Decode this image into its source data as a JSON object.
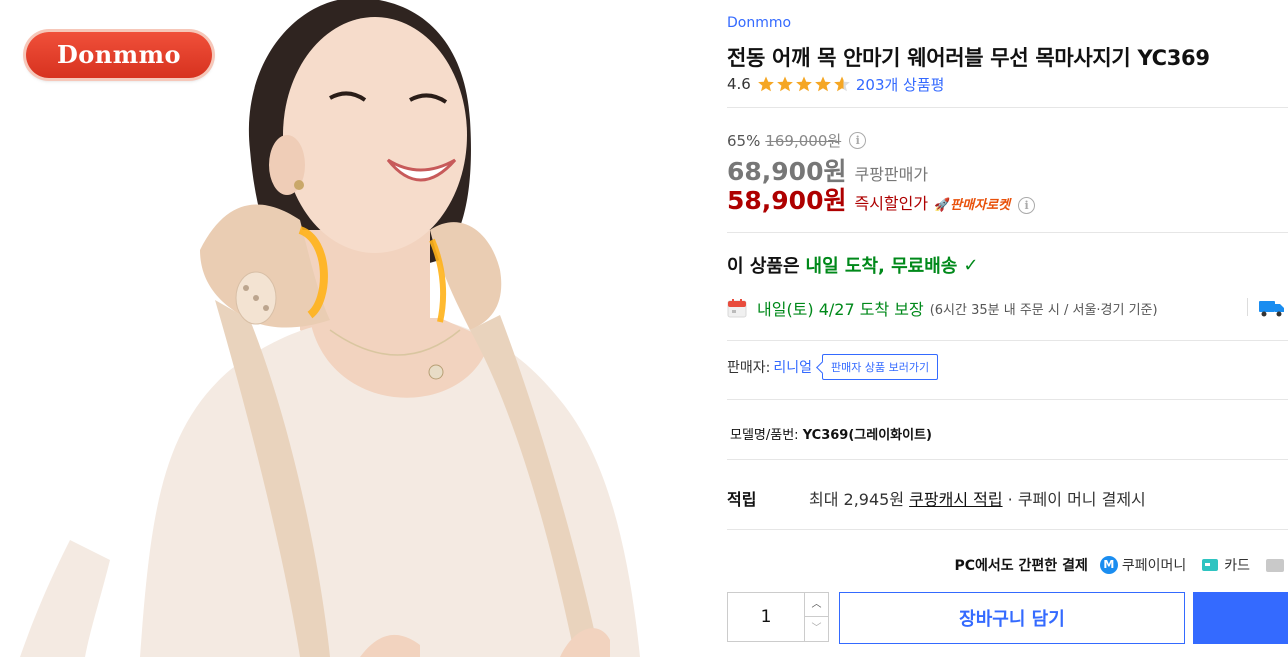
{
  "image": {
    "brand_badge": "Donmmo"
  },
  "product": {
    "brand": "Donmmo",
    "title": "전동 어깨 목 안마기 웨어러블 무선 목마사지기 YC369",
    "rating": "4.6",
    "rating_value": 4.6,
    "review_count": "203개 상품평",
    "discount": "65%",
    "original_price": "169,000원",
    "sale_price": "68,900원",
    "sale_label": "쿠팡판매가",
    "instant_price": "58,900원",
    "instant_label": "즉시할인가",
    "seller_rocket": "판매자로켓"
  },
  "delivery": {
    "headline_prefix": "이 상품은",
    "headline_highlight": "내일 도착, 무료배송",
    "date": "내일(토) 4/27 도착 보장",
    "note": "(6시간 35분  내 주문 시 / 서울·경기 기준)"
  },
  "seller": {
    "label": "판매자:",
    "name": "리니얼",
    "button": "판매자 상품 보러가기"
  },
  "model": {
    "label": "모델명/품번:",
    "value": "YC369(그레이화이트)"
  },
  "points": {
    "label": "적립",
    "text_before": "최대 2,945원",
    "link": "쿠팡캐시 적립",
    "text_after": "· 쿠페이 머니 결제시"
  },
  "payment": {
    "title": "PC에서도 간편한 결제",
    "m_badge": "M",
    "option_coupay": "쿠페이머니",
    "option_card": "카드"
  },
  "purchase": {
    "quantity": "1",
    "cart_button": "장바구니 담기"
  },
  "colors": {
    "accent_blue": "#346aff",
    "price_red": "#ae0000",
    "delivery_green": "#00891a",
    "rocket_orange": "#e8510b",
    "star_yellow": "#f5a623"
  }
}
